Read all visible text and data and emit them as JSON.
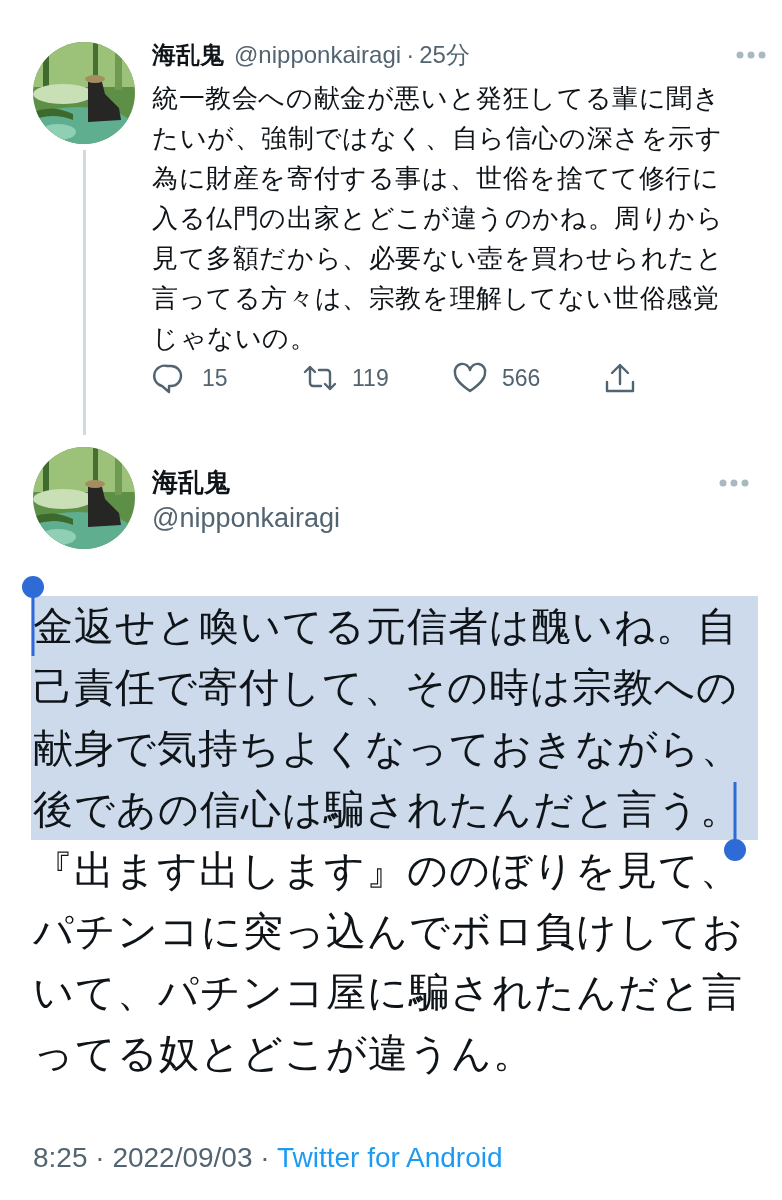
{
  "thread_tweet": {
    "name": "海乱鬼",
    "handle": "@nipponkairagi",
    "separator": "·",
    "time": "25分",
    "text": "統一教会への献金が悪いと発狂してる輩に聞きたいが、強制ではなく、自ら信心の深さを示す為に財産を寄付する事は、世俗を捨てて修行に入る仏門の出家とどこが違うのかね。周りから見て多額だから、必要ない壺を買わせられたと言ってる方々は、宗教を理解してない世俗感覚じゃないの。",
    "actions": [
      {
        "kind": "reply",
        "count": "15"
      },
      {
        "kind": "retweet",
        "count": "119"
      },
      {
        "kind": "like",
        "count": "566"
      },
      {
        "kind": "share"
      }
    ]
  },
  "main_tweet": {
    "name": "海乱鬼",
    "handle": "@nipponkairagi",
    "body": [
      {
        "text": "金返せと喚いてる元信者は醜いね。自己責任で寄付して、その時は宗教への献身で気持ちよくなっておきながら、後であの信心は騙されたんだと言う。",
        "selected": true
      },
      {
        "text": "『出ます出します』ののぼりを見て、パチンコに突っ込んでボロ負けしておいて、パチンコ屋に騙されたんだと言ってる奴とどこが違うん。",
        "selected": false
      }
    ],
    "timestamp": "8:25 · 2022/09/03 ·",
    "source": "Twitter for Android"
  }
}
